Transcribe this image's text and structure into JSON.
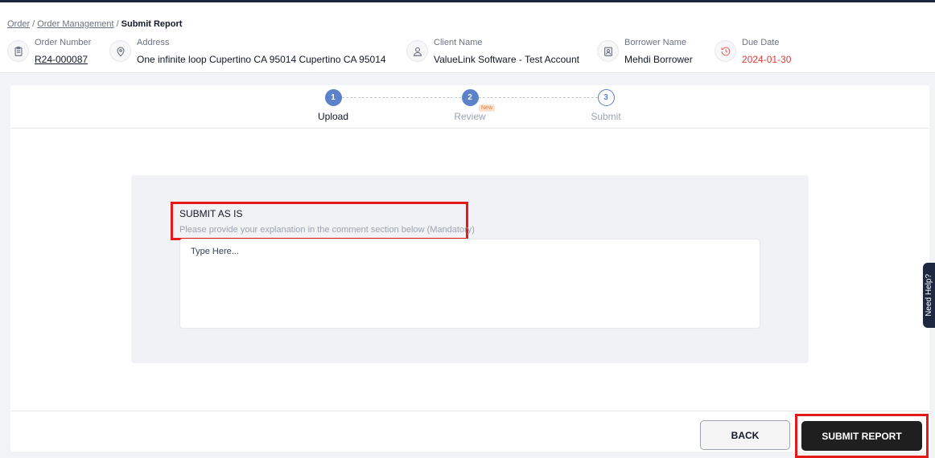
{
  "breadcrumb": {
    "items": [
      "Order",
      "Order Management"
    ],
    "current": "Submit Report",
    "separator": "/"
  },
  "order_info": [
    {
      "label": "Order Number",
      "value": "R24-000087",
      "icon": "clipboard-icon"
    },
    {
      "label": "Address",
      "value": "One infinite loop Cupertino CA 95014 Cupertino CA 95014",
      "icon": "location-pin-icon"
    },
    {
      "label": "Client Name",
      "value": "ValueLink Software - Test Account",
      "icon": "user-icon"
    },
    {
      "label": "Borrower Name",
      "value": "Mehdi Borrower",
      "icon": "id-badge-icon"
    },
    {
      "label": "Due Date",
      "value": "2024-01-30",
      "icon": "clock-history-icon",
      "value_color": "#e53935"
    }
  ],
  "stepper": {
    "steps": [
      {
        "number": "1",
        "label": "Upload",
        "state": "active"
      },
      {
        "number": "2",
        "label": "Review",
        "state": "done",
        "badge": "New"
      },
      {
        "number": "3",
        "label": "Submit",
        "state": "pending"
      }
    ],
    "accent": "#5b82c9"
  },
  "submit_panel": {
    "title": "SUBMIT AS IS",
    "subtitle": "Please provide your explanation in the comment section below (Mandatory)",
    "comment_placeholder": "Type Here...",
    "comment_value": ""
  },
  "footer": {
    "back_label": "BACK",
    "submit_label": "SUBMIT REPORT"
  },
  "need_help": "Need Help?",
  "colors": {
    "highlight": "#e61919",
    "dark": "#1c2840",
    "due_date": "#e53935"
  }
}
